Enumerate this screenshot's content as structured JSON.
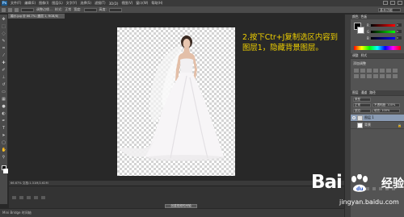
{
  "menubar": {
    "logo": "Ps",
    "items": [
      "文件(F)",
      "编辑(E)",
      "图像(I)",
      "图层(L)",
      "文字(Y)",
      "选择(S)",
      "滤镜(T)",
      "3D(D)",
      "视图(V)",
      "窗口(W)",
      "帮助(H)"
    ]
  },
  "optionsbar": {
    "items": [
      "调整边缘...",
      "样式:",
      "正常",
      "宽度:",
      "高度:"
    ],
    "workspace": "基本功能"
  },
  "document": {
    "tab_label": "婚纱.jpg @ 66.7% (图层 1, RGB/8)"
  },
  "annotation": {
    "text": "2.按下Ctr+J复制选区内容到图层1，隐藏背景图层。"
  },
  "status": {
    "zoom": "66.67%",
    "doc_info": "文档:1.31M/2.62M"
  },
  "timeline": {
    "create_label": "创建视频时间轴"
  },
  "bottom": {
    "label": "Mini Bridge   时间轴"
  },
  "panels": {
    "color_tabs": [
      "颜色",
      "色板"
    ],
    "sliders": [
      {
        "label": "R",
        "value": "0",
        "color": "#ff0000"
      },
      {
        "label": "G",
        "value": "0",
        "color": "#00ff00"
      },
      {
        "label": "B",
        "value": "0",
        "color": "#0000ff"
      }
    ],
    "adj_tabs": [
      "调整",
      "样式"
    ],
    "adj_title": "添加调整",
    "layer_tabs": [
      "图层",
      "通道",
      "路径"
    ],
    "layers_kind": "类型",
    "blend_mode": "正常",
    "opacity_label": "不透明度: 100%",
    "fill_label": "填充: 100%",
    "lock_label": "锁定:",
    "layers": [
      {
        "name": "图层 1",
        "selected": true
      },
      {
        "name": "背景",
        "selected": false
      }
    ]
  },
  "watermark": {
    "brand": "Bai",
    "brand2": "经验",
    "url": "jingyan.baidu.com"
  }
}
